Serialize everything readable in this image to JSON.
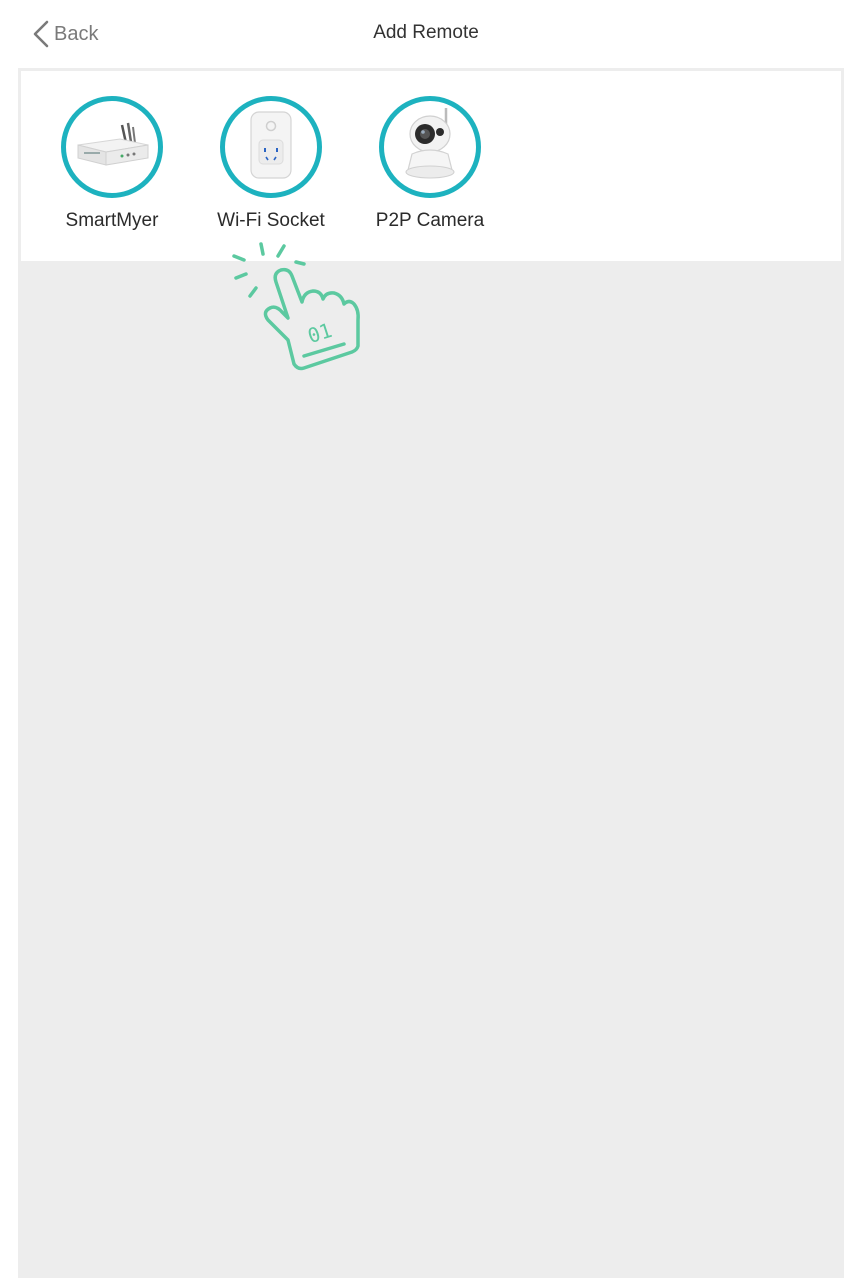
{
  "header": {
    "back_label": "Back",
    "title": "Add Remote"
  },
  "devices": [
    {
      "label": "SmartMyer",
      "icon": "router-icon"
    },
    {
      "label": "Wi-Fi Socket",
      "icon": "smart-socket-icon"
    },
    {
      "label": "P2P Camera",
      "icon": "ip-camera-icon"
    }
  ],
  "annotation": {
    "step_number": "01",
    "icon": "tap-hand-icon",
    "color": "#5cc9a0"
  },
  "colors": {
    "accent_ring": "#1db2bf",
    "content_bg": "#ededed",
    "panel_bg": "#ffffff"
  }
}
